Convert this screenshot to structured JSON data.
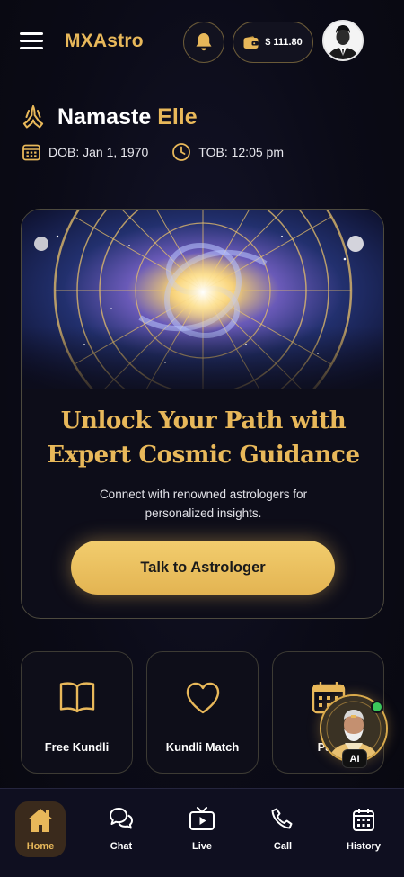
{
  "header": {
    "brand": "MXAstro",
    "wallet_amount": "$ 111.80",
    "icons": [
      "menu-icon",
      "bell-icon",
      "wallet-icon",
      "avatar"
    ]
  },
  "greeting": {
    "salutation": "Namaste",
    "name": "Elle",
    "dob": "DOB: Jan 1, 1970",
    "tob": "TOB: 12:05 pm"
  },
  "hero": {
    "title_line1": "Unlock Your Path with",
    "title_line2": "Expert Cosmic Guidance",
    "subtitle_line1": "Connect with renowned astrologers for",
    "subtitle_line2": "personalized insights.",
    "cta": "Talk to Astrologer"
  },
  "features": [
    {
      "label": "Free Kundli",
      "icon": "book-icon"
    },
    {
      "label": "Kundli Match",
      "icon": "heart-icon"
    },
    {
      "label": "Pan",
      "icon": "calendar-icon"
    }
  ],
  "ai_assistant": {
    "badge": "AI",
    "status": "online"
  },
  "bottom_nav": [
    {
      "label": "Home",
      "icon": "home-icon",
      "active": true
    },
    {
      "label": "Chat",
      "icon": "chat-icon",
      "active": false
    },
    {
      "label": "Live",
      "icon": "tv-icon",
      "active": false
    },
    {
      "label": "Call",
      "icon": "phone-icon",
      "active": false
    },
    {
      "label": "History",
      "icon": "calendar-icon",
      "active": false
    }
  ],
  "colors": {
    "accent": "#e8b85a",
    "background": "#0c0c1a",
    "online": "#3bc75b"
  }
}
